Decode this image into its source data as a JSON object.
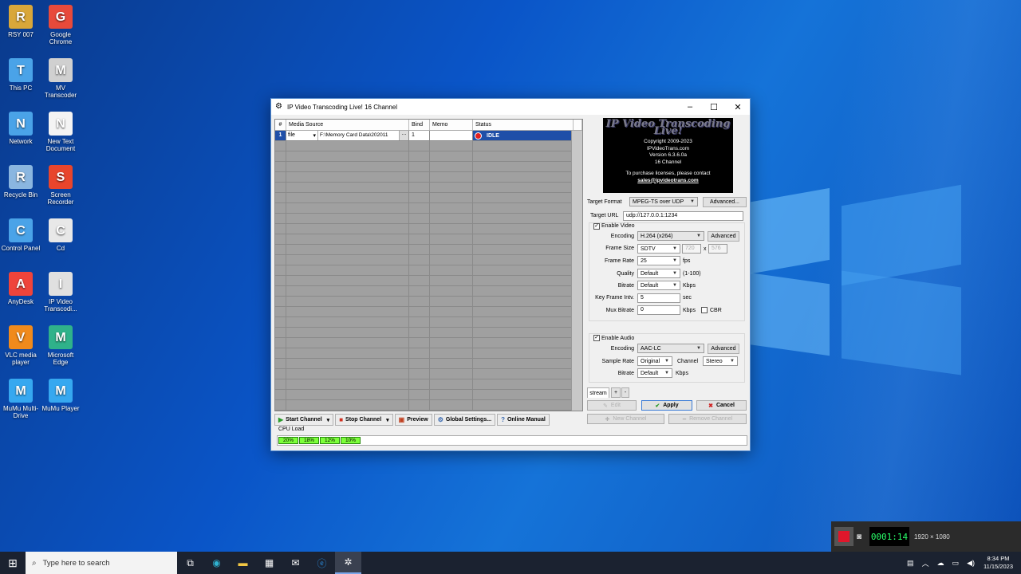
{
  "desktop": {
    "icons": [
      {
        "label": "RSY 007",
        "icon": "user-folder-icon",
        "color": "#d9a73a"
      },
      {
        "label": "Google Chrome",
        "icon": "chrome-icon",
        "color": "#e84a3b"
      },
      {
        "label": "This PC",
        "icon": "computer-icon",
        "color": "#4aa3e8"
      },
      {
        "label": "MV Transcoder",
        "icon": "film-icon",
        "color": "#d0d0d0"
      },
      {
        "label": "Network",
        "icon": "network-icon",
        "color": "#4aa3e8"
      },
      {
        "label": "New Text Document",
        "icon": "document-icon",
        "color": "#f4f4f4"
      },
      {
        "label": "Recycle Bin",
        "icon": "recycle-bin-icon",
        "color": "#8ab6e0"
      },
      {
        "label": "Screen Recorder",
        "icon": "record-icon",
        "color": "#e8452c"
      },
      {
        "label": "Control Panel",
        "icon": "control-panel-icon",
        "color": "#4aa3e8"
      },
      {
        "label": "Cd",
        "icon": "folder-icon",
        "color": "#e8e8e8"
      },
      {
        "label": "AnyDesk",
        "icon": "anydesk-icon",
        "color": "#ef443b"
      },
      {
        "label": "IP Video Transcodi...",
        "icon": "film-reel-icon",
        "color": "#e0e0e0"
      },
      {
        "label": "VLC media player",
        "icon": "vlc-icon",
        "color": "#f08a1c"
      },
      {
        "label": "Microsoft Edge",
        "icon": "edge-icon",
        "color": "#2fb28a"
      },
      {
        "label": "MuMu Multi-Drive",
        "icon": "mumu-icon",
        "color": "#36a8f0"
      },
      {
        "label": "MuMu Player",
        "icon": "mumu-icon",
        "color": "#36a8f0"
      }
    ]
  },
  "window": {
    "title": "IP Video Transcoding Live! 16 Channel",
    "minimize": "–",
    "maximize": "☐",
    "close": "✕"
  },
  "grid": {
    "headers": [
      "#",
      "Media Source",
      "Bind",
      "Memo",
      "Status"
    ],
    "row": {
      "num": "1",
      "source_type": "file",
      "source_path": "F:\\Memory Card Data\\202011",
      "browse": "...",
      "bind": "1",
      "memo": "",
      "status": "IDLE"
    }
  },
  "banner": {
    "logo": "IP Video Transcoding Live!",
    "copyright": "Copyright 2009-2023",
    "site": "IPVideoTrans.com",
    "version": "Version 6.3.6.0a",
    "channels": "16 Channel",
    "license_note": "To purchase licenses, please contact",
    "email": "sales@ipvideotrans.com"
  },
  "settings": {
    "target_format_label": "Target Format",
    "target_format": "MPEG-TS over UDP",
    "advanced_btn": "Advanced...",
    "target_url_label": "Target URL",
    "target_url": "udp://127.0.0.1:1234",
    "enable_video": "Enable Video",
    "encoding_label": "Encoding",
    "video_encoding": "H.264 (x264)",
    "advanced_short": "Advanced",
    "frame_size_label": "Frame Size",
    "frame_size": "SDTV",
    "width": "720",
    "x": "x",
    "height": "576",
    "frame_rate_label": "Frame Rate",
    "frame_rate": "25",
    "fps": "fps",
    "quality_label": "Quality",
    "quality": "Default",
    "quality_range": "(1-100)",
    "bitrate_label": "Bitrate",
    "bitrate": "Default",
    "kbps": "Kbps",
    "key_frame_label": "Key Frame Intv.",
    "key_frame": "5",
    "sec": "sec",
    "mux_bitrate_label": "Mux Bitrate",
    "mux_bitrate": "0",
    "cbr": "CBR",
    "enable_audio": "Enable Audio",
    "audio_encoding": "AAC-LC",
    "sample_rate_label": "Sample Rate",
    "sample_rate": "Original",
    "channel_label": "Channel",
    "channel": "Stereo",
    "audio_bitrate": "Default",
    "stream_tab": "stream",
    "add_tab": "+",
    "remove_tab": "-",
    "edit_btn": "Edit",
    "apply_btn": "Apply",
    "cancel_btn": "Cancel",
    "new_channel_btn": "New Channel",
    "remove_channel_btn": "Remove Channel"
  },
  "toolbar": {
    "start": "Start Channel",
    "stop": "Stop Channel",
    "preview": "Preview",
    "global": "Global Settings...",
    "manual": "Online Manual"
  },
  "cpu": {
    "label": "CPU Load",
    "cores": [
      "20%",
      "18%",
      "12%",
      "10%"
    ]
  },
  "recorder": {
    "time": "0001:14",
    "resolution": "1920 × 1080"
  },
  "taskbar": {
    "search_placeholder": "Type here to search",
    "time": "8:34 PM",
    "date": "11/15/2023"
  }
}
